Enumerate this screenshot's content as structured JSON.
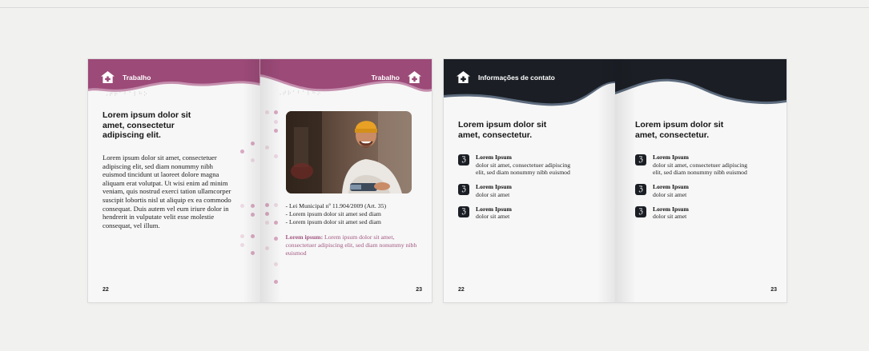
{
  "spread1": {
    "left_page": {
      "header": "Trabalho",
      "braille": "⠠⠞⠗⠁⠃⠁⠇⠓⠕",
      "title": "Lorem ipsum dolor sit amet, consectetur adipiscing elit.",
      "body": "Lorem ipsum dolor sit amet, consectetuer adipiscing elit, sed diam nonummy nibh euismod tincidunt ut laoreet dolore magna aliquam erat volutpat. Ut wisi enim ad minim veniam, quis nostrud exerci tation ullamcorper suscipit lobortis nisl ut aliquip ex ea commodo consequat. Duis autem vel eum iriure dolor in hendrerit in vulputate velit esse molestie consequat, vel illum.",
      "page_number": "22"
    },
    "right_page": {
      "header": "Trabalho",
      "braille": "⠠⠞⠗⠁⠃⠁⠇⠓⠕",
      "bullets": [
        "- Lei Municipal nº 11.904/2009 (Art. 35)",
        "- Lorem ipsum dolor sit amet sed diam",
        "- Lorem ipsum dolor sit amet sed diam"
      ],
      "note_bold": "Lorem ipsum:",
      "note_text": " Lorem ipsum dolor sit amet, consectetuer adipiscing elit, sed diam nonummy nibh euismod",
      "page_number": "23"
    }
  },
  "spread2": {
    "left_page": {
      "header": "Informações de contato",
      "title": "Lorem ipsum dolor sit amet, consectetur.",
      "contacts": [
        {
          "title": "Lorem Ipsum",
          "text": "dolor sit amet, consectetuer adipiscing elit, sed diam nonummy nibh euismod"
        },
        {
          "title": "Lorem Ipsum",
          "text": "dolor sit amet"
        },
        {
          "title": "Lorem Ipsum",
          "text": "dolor sit amet"
        }
      ],
      "page_number": "22"
    },
    "right_page": {
      "title": "Lorem ipsum dolor sit amet, consectetur.",
      "contacts": [
        {
          "title": "Lorem Ipsum",
          "text": "dolor sit amet, consectetuer adipiscing elit, sed diam nonummy nibh euismod"
        },
        {
          "title": "Lorem Ipsum",
          "text": "dolor sit amet"
        },
        {
          "title": "Lorem Ipsum",
          "text": "dolor sit amet"
        }
      ],
      "page_number": "23"
    }
  },
  "colors": {
    "magenta": "#9c4a78",
    "magenta_light": "#c58fae",
    "dark": "#1b1f25",
    "pink_dot": "#e2c3d2"
  },
  "icons": {
    "header_icon": "house-plus-icon",
    "contact_icon": "hearing-assist-icon"
  }
}
